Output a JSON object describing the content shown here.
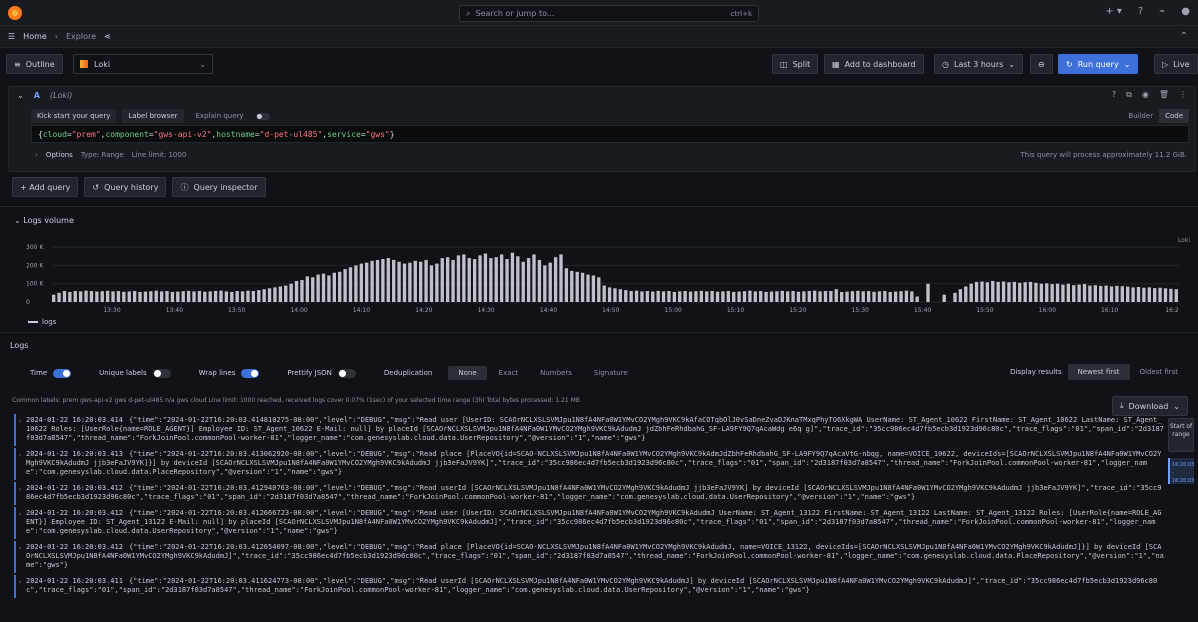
{
  "topbar": {
    "search_placeholder": "Search or jump to...",
    "shortcut": "ctrl+k"
  },
  "breadcrumb": {
    "home": "Home",
    "sep": "›",
    "explore": "Explore"
  },
  "toolbar": {
    "outline_label": "Outline",
    "datasource": "Loki",
    "split_label": "Split",
    "add_to_dashboard_label": "Add to dashboard",
    "time_range_label": "Last 3 hours",
    "run_query_label": "Run query",
    "live_label": "Live"
  },
  "query": {
    "letter": "A",
    "ds_name": "(Loki)",
    "kick_start_label": "Kick start your query",
    "label_browser_label": "Label browser",
    "explain_label": "Explain query",
    "builder_label": "Builder",
    "code_label": "Code",
    "expression": {
      "open": "{",
      "k1": "cloud",
      "v1": "\"prem\"",
      "k2": "component",
      "v2": "\"gws-api-v2\"",
      "k3": "hostname",
      "v3": "\"d-pet-ul485\"",
      "k4": "service",
      "v4": "\"gws\"",
      "close": "}"
    },
    "options_label": "Options",
    "options_type": "Type: Range",
    "options_limit": "Line limit: 1000",
    "process_note": "This query will process approximately 11.2 GiB."
  },
  "actions": {
    "add_query": "+ Add query",
    "query_history": "Query history",
    "query_inspector": "Query inspector"
  },
  "logs_volume": {
    "title": "Logs volume",
    "legend": "logs",
    "loki_tag": "Loki"
  },
  "chart_data": {
    "type": "bar",
    "title": "Logs volume",
    "ylim": [
      0,
      350000
    ],
    "y_ticks": [
      "300 K",
      "200 K",
      "100 K",
      "0"
    ],
    "x_ticks": [
      "13:30",
      "13:40",
      "13:50",
      "14:00",
      "14:10",
      "14:20",
      "14:30",
      "14:40",
      "14:50",
      "15:00",
      "15:10",
      "15:20",
      "15:30",
      "15:40",
      "15:50",
      "16:00",
      "16:10",
      "16:2"
    ],
    "series": [
      {
        "name": "logs",
        "values": [
          40000,
          50000,
          60000,
          55000,
          60000,
          58000,
          62000,
          60000,
          57000,
          59000,
          61000,
          58000,
          60000,
          56000,
          58000,
          60000,
          55000,
          57000,
          59000,
          62000,
          58000,
          60000,
          55000,
          57000,
          59000,
          61000,
          58000,
          60000,
          56000,
          58000,
          60000,
          62000,
          58000,
          55000,
          60000,
          58000,
          62000,
          60000,
          65000,
          70000,
          75000,
          80000,
          85000,
          90000,
          100000,
          115000,
          120000,
          140000,
          135000,
          150000,
          155000,
          145000,
          160000,
          165000,
          180000,
          190000,
          200000,
          210000,
          215000,
          225000,
          230000,
          235000,
          240000,
          230000,
          220000,
          210000,
          215000,
          225000,
          220000,
          230000,
          200000,
          210000,
          240000,
          245000,
          230000,
          255000,
          260000,
          240000,
          235000,
          255000,
          265000,
          240000,
          245000,
          260000,
          235000,
          270000,
          250000,
          220000,
          240000,
          260000,
          230000,
          200000,
          215000,
          245000,
          260000,
          185000,
          170000,
          165000,
          160000,
          150000,
          145000,
          135000,
          90000,
          80000,
          75000,
          70000,
          65000,
          60000,
          62000,
          58000,
          60000,
          57000,
          61000,
          58000,
          60000,
          55000,
          58000,
          60000,
          57000,
          59000,
          61000,
          58000,
          60000,
          56000,
          58000,
          60000,
          55000,
          57000,
          59000,
          62000,
          58000,
          60000,
          55000,
          57000,
          59000,
          61000,
          58000,
          60000,
          56000,
          58000,
          60000,
          62000,
          58000,
          60000,
          60000,
          70000,
          55000,
          57000,
          59000,
          61000,
          58000,
          60000,
          56000,
          58000,
          60000,
          55000,
          57000,
          59000,
          62000,
          58000,
          30000,
          0,
          100000,
          0,
          0,
          40000,
          0,
          50000,
          70000,
          85000,
          100000,
          110000,
          112000,
          108000,
          115000,
          110000,
          112000,
          108000,
          110000,
          105000,
          108000,
          110000,
          105000,
          100000,
          102000,
          98000,
          100000,
          95000,
          100000,
          92000,
          95000,
          98000,
          90000,
          92000,
          88000,
          90000,
          85000,
          88000,
          86000,
          84000,
          80000,
          82000,
          78000,
          80000,
          76000,
          78000,
          75000,
          72000,
          70000
        ]
      }
    ]
  },
  "logs": {
    "title": "Logs",
    "opt_time": "Time",
    "opt_unique": "Unique labels",
    "opt_wrap": "Wrap lines",
    "opt_prettify": "Prettify JSON",
    "dedup_label": "Deduplication",
    "dedup_none": "None",
    "dedup_exact": "Exact",
    "dedup_numbers": "Numbers",
    "dedup_signature": "Signature",
    "display_results": "Display results",
    "newest_first": "Newest first",
    "oldest_first": "Oldest first",
    "common_labels": "Common labels: prem gws-api-v2 gws d-pet-ul485 n/a gws cloud    Line limit: 1000 reached, received logs cover 0.07% (1sec) of your selected time range (3h)    Total bytes processed: 1.21 MB",
    "download_label": "Download",
    "start_of_range": "Start of range",
    "time_marker": "16:20:03 - 16:20:03",
    "rows": [
      {
        "ts": "2024-01-22 16:20:03.414",
        "line": "{\"time\":\"2024-01-22T16:20:03.414810275-08:00\",\"level\":\"DEBUG\",\"msg\":\"Read user [UserID: SCAOrNCLXSLSVMJpu1N8fA4NFa0W1YMvCO2YMgh9VKC9kAfaCOTqbOlJ0vSaDneZvaDJKnaTMxqPhyTO6XkgWA UserName: ST_Agent_10622 FirstName: ST_Agent_10622 LastName: ST_Agent_10622 Roles: [UserRole{name=ROLE_AGENT}] Employee ID: ST_Agent_10622 E-Mail: null] by placeId [SCAOrNCLXSLSVMJpu1N8fA4NFa0W1YMvCO2YMgh9VKC9kAdudmJ jdZbhFeRhdbahG_SF-LA9FY9Q7qAcaWdg e6q g]\",\"trace_id\":\"35cc986ec4d7fb5ecb3d1923d96c80c\",\"trace_flags\":\"01\",\"span_id\":\"2d3187f03d7a8547\",\"thread_name\":\"ForkJoinPool.commonPool-worker-81\",\"logger_name\":\"com.genesyslab.cloud.data.UserRepository\",\"@version\":\"1\",\"name\":\"gws\"}"
      },
      {
        "ts": "2024-01-22 16:20:03.413",
        "line": "{\"time\":\"2024-01-22T16:20:03.413062920-08:00\",\"level\":\"DEBUG\",\"msg\":\"Read place [PlaceVO{id=SCAO-NCLXSLSVMJpu1N8fA4NFa0W1YMvCO2YMgh9VKC9kAdmJdZbhFeRhdbahG_SF-LA9FY9Q7qAcaVtG-nbqg, name=VOICE_10622, deviceIds=[SCAOrNCLXSLSVMJpu1N8fA4NFa0W1YMvCO2YMgh9VKC9kAdudmJ jjb3eFaJV9YK]}] by deviceId [SCAOrNCLXSLSVMJpu1N8fA4NFa0W1YMvCO2YMgh9VKC9kAdudmJ jjb3eFaJV9YK]\",\"trace_id\":\"35cc986ec4d7fb5ecb3d1923d96c80c\",\"trace_flags\":\"01\",\"span_id\":\"2d3187f03d7a8547\",\"thread_name\":\"ForkJoinPool.commonPool-worker-81\",\"logger_name\":\"com.genesyslab.cloud.data.PlaceRepository\",\"@version\":\"1\",\"name\":\"gws\"}"
      },
      {
        "ts": "2024-01-22 16:20:03.412",
        "line": "{\"time\":\"2024-01-22T16:20:03.412940763-08:00\",\"level\":\"DEBUG\",\"msg\":\"Read userId [SCAOrNCLXSLSVMJpu1N8fA4NFa0W1YMvCO2YMgh9VKC9kAdudmJ jjb3eFaJV9YK] by deviceId [SCAOrNCLXSLSVMJpu1N8fA4NFa0W1YMvCO2YMgh9VKC9kAdudmJ jjb3eFaJV9YK]\",\"trace_id\":\"35cc986ec4d7fb5ecb3d1923d96c80c\",\"trace_flags\":\"01\",\"span_id\":\"2d3187f03d7a8547\",\"thread_name\":\"ForkJoinPool.commonPool-worker-81\",\"logger_name\":\"com.genesyslab.cloud.data.UserRepository\",\"@version\":\"1\",\"name\":\"gws\"}"
      },
      {
        "ts": "2024-01-22 16:20:03.412",
        "line": "{\"time\":\"2024-01-22T16:20:03.412666723-08:00\",\"level\":\"DEBUG\",\"msg\":\"Read user [UserID: SCAOrNCLXSLSVMJpu1N8fA4NFa0W1YMvCO2YMgh9VKC9kAdudmJ UserName: ST_Agent_13122 FirstName: ST_Agent_13122 LastName: ST_Agent_13122 Roles: [UserRole{name=ROLE_AGENT}] Employee ID: ST_Agent_13122 E-Mail: null] by placeId [SCAOrNCLXSLSVMJpu1N8fA4NFa0W1YMvCO2YMgh9VKC9kAdudmJ]\",\"trace_id\":\"35cc986ec4d7fb5ecb3d1923d96c80c\",\"trace_flags\":\"01\",\"span_id\":\"2d3187f03d7a8547\",\"thread_name\":\"ForkJoinPool.commonPool-worker-81\",\"logger_name\":\"com.genesyslab.cloud.data.UserRepository\",\"@version\":\"1\",\"name\":\"gws\"}"
      },
      {
        "ts": "2024-01-22 16:20:03.412",
        "line": "{\"time\":\"2024-01-22T16:20:03.412654097-08:00\",\"level\":\"DEBUG\",\"msg\":\"Read place [PlaceVO{id=SCAO-NCLXSLSVMJpu1N8fA4NFa0W1YMvCO2YMgh9VKC9kAdudmJ, name=VOICE_13122, deviceIds=[SCAOrNCLXSLSVMJpu1N8fA4NFa0W1YMvCO2YMgh9VKC9kAdudmJ]}] by deviceId [SCAOrNCLXSLSVMJpu1N8fA4NFa0W1YMvCO2YMgh9VKC9kAdudmJ]\",\"trace_id\":\"35cc986ec4d7fb5ecb3d1923d96c80c\",\"trace_flags\":\"01\",\"span_id\":\"2d3187f03d7a8547\",\"thread_name\":\"ForkJoinPool.commonPool-worker-81\",\"logger_name\":\"com.genesyslab.cloud.data.PlaceRepository\",\"@version\":\"1\",\"name\":\"gws\"}"
      },
      {
        "ts": "2024-01-22 16:20:03.411",
        "line": "{\"time\":\"2024-01-22T16:20:03.411624773-08:00\",\"level\":\"DEBUG\",\"msg\":\"Read userId [SCAOrNCLXSLSVMJpu1N8fA4NFa0W1YMvCO2YMgh9VKC9kAdudmJ] by deviceId [SCAOrNCLXSLSVMJpu1N8fA4NFa0W1YMvCO2YMgh9VKC9kAdudmJ]\",\"trace_id\":\"35cc986ec4d7fb5ecb3d1923d96c80c\",\"trace_flags\":\"01\",\"span_id\":\"2d3187f03d7a8547\",\"thread_name\":\"ForkJoinPool.commonPool-worker-81\",\"logger_name\":\"com.genesyslab.cloud.data.UserRepository\",\"@version\":\"1\",\"name\":\"gws\"}"
      }
    ]
  }
}
